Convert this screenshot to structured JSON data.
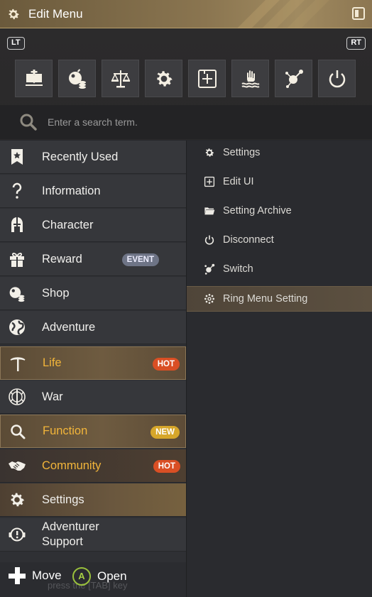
{
  "window": {
    "title": "Edit Menu"
  },
  "shoulders": {
    "left": "LT",
    "right": "RT"
  },
  "quick_icons": [
    "book-icon",
    "shop-icon",
    "scales-icon",
    "gear-icon",
    "edit-ui-icon",
    "hand-water-icon",
    "switch-icon",
    "power-icon"
  ],
  "search": {
    "placeholder": "Enter a search term."
  },
  "left_menu": [
    {
      "label": "Recently Used",
      "icon": "bookmark-star-icon",
      "badge": ""
    },
    {
      "label": "Information",
      "icon": "question-icon",
      "badge": ""
    },
    {
      "label": "Character",
      "icon": "helmet-icon",
      "badge": ""
    },
    {
      "label": "Reward",
      "icon": "gift-icon",
      "badge": "EVENT"
    },
    {
      "label": "Shop",
      "icon": "shop-icon",
      "badge": ""
    },
    {
      "label": "Adventure",
      "icon": "globe-icon",
      "badge": ""
    },
    {
      "label": "Life",
      "icon": "pickaxe-icon",
      "badge": "HOT"
    },
    {
      "label": "War",
      "icon": "war-emblem-icon",
      "badge": ""
    },
    {
      "label": "Function",
      "icon": "search-icon",
      "badge": "NEW"
    },
    {
      "label": "Community",
      "icon": "handshake-icon",
      "badge": "HOT"
    },
    {
      "label": "Settings",
      "icon": "gear-icon",
      "badge": ""
    },
    {
      "label_line1": "Adventurer",
      "label_line2": "Support",
      "icon": "support-headset-icon",
      "badge": ""
    }
  ],
  "submenu": [
    {
      "label": "Settings",
      "icon": "gear-icon"
    },
    {
      "label": "Edit UI",
      "icon": "edit-ui-icon"
    },
    {
      "label": "Setting Archive",
      "icon": "folder-icon"
    },
    {
      "label": "Disconnect",
      "icon": "power-icon"
    },
    {
      "label": "Switch",
      "icon": "switch-icon"
    },
    {
      "label": "Ring Menu Setting",
      "icon": "ring-menu-icon"
    }
  ],
  "hints": {
    "move": "Move",
    "open": "Open",
    "a_button": "A",
    "ghost": "press the [TAB] key"
  },
  "colors": {
    "accent_gold": "#f2b53a",
    "hot": "#d94f24",
    "new": "#d6a62a",
    "event": "#6e7486"
  }
}
